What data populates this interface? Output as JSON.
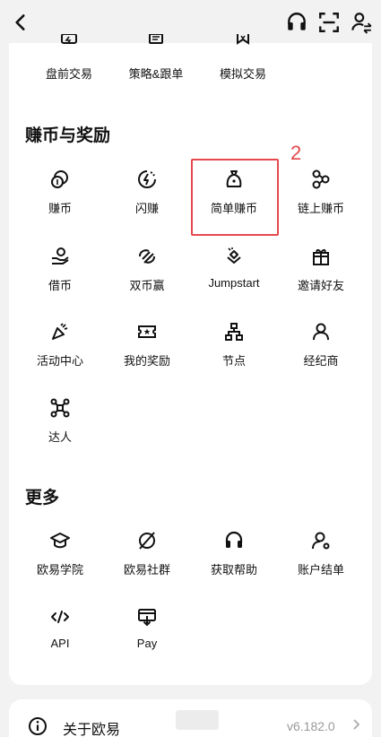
{
  "top_grid": [
    {
      "label": "盘前交易",
      "icon": "pre-market-icon"
    },
    {
      "label": "策略&跟单",
      "icon": "strategy-icon"
    },
    {
      "label": "模拟交易",
      "icon": "demo-trading-icon"
    }
  ],
  "earn_section": {
    "title": "赚币与奖励",
    "items": [
      {
        "label": "赚币",
        "icon": "earn-icon"
      },
      {
        "label": "闪赚",
        "icon": "flash-earn-icon"
      },
      {
        "label": "简单赚币",
        "icon": "simple-earn-icon"
      },
      {
        "label": "链上赚币",
        "icon": "onchain-earn-icon"
      },
      {
        "label": "借币",
        "icon": "loan-icon"
      },
      {
        "label": "双币赢",
        "icon": "dual-investment-icon"
      },
      {
        "label": "Jumpstart",
        "icon": "jumpstart-icon"
      },
      {
        "label": "邀请好友",
        "icon": "gift-icon"
      },
      {
        "label": "活动中心",
        "icon": "events-icon"
      },
      {
        "label": "我的奖励",
        "icon": "rewards-icon"
      },
      {
        "label": "节点",
        "icon": "node-icon"
      },
      {
        "label": "经纪商",
        "icon": "broker-icon"
      },
      {
        "label": "达人",
        "icon": "expert-icon"
      }
    ]
  },
  "more_section": {
    "title": "更多",
    "items": [
      {
        "label": "欧易学院",
        "icon": "academy-icon"
      },
      {
        "label": "欧易社群",
        "icon": "community-icon"
      },
      {
        "label": "获取帮助",
        "icon": "support-icon"
      },
      {
        "label": "账户结单",
        "icon": "statement-icon"
      },
      {
        "label": "API",
        "icon": "api-icon"
      },
      {
        "label": "Pay",
        "icon": "pay-icon"
      }
    ]
  },
  "annotation": {
    "number": "2",
    "color": "#e5484d"
  },
  "about": {
    "label": "关于欧易",
    "version": "v6.182.0"
  },
  "colors": {
    "background": "#f2f2f2",
    "card": "#ffffff",
    "highlight": "#e5484d"
  }
}
